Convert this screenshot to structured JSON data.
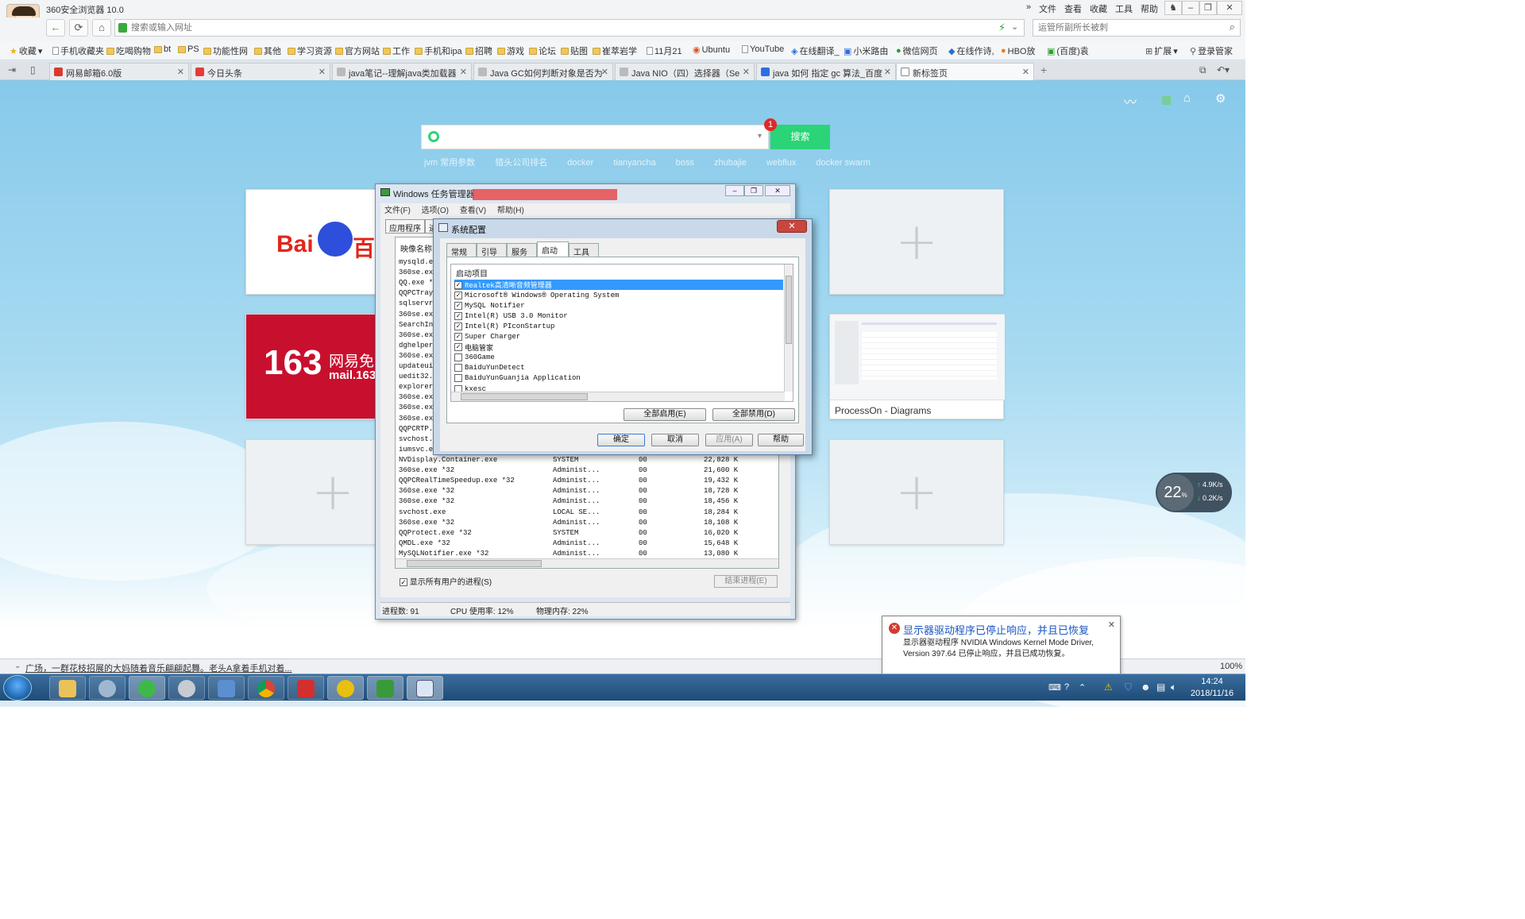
{
  "browser": {
    "title": "360安全浏览器 10.0",
    "menu": [
      "文件",
      "查看",
      "收藏",
      "工具",
      "帮助"
    ],
    "address_placeholder": "搜索或输入网址",
    "search_placeholder": "运管所副所长被刺"
  },
  "bookmarks": [
    "收藏",
    "手机收藏夹",
    "吃喝购物",
    "bt",
    "PS",
    "功能性网",
    "其他",
    "学习资源",
    "官方网站",
    "工作",
    "手机和ipa",
    "招聘",
    "游戏",
    "论坛",
    "贴图",
    "崔萃岩学",
    "11月21",
    "Ubuntu",
    "YouTube",
    "在线翻译_",
    "小米路由",
    "微信网页",
    "在线作诗,",
    "HBO放",
    "(百度)袁",
    "扩展",
    "登录管家"
  ],
  "tabs": [
    {
      "label": "网易邮箱6.0版",
      "active": false,
      "color": "#d93a2e"
    },
    {
      "label": "今日头条",
      "active": false,
      "color": "#e53b3b"
    },
    {
      "label": "java笔记--理解java类加载器",
      "active": false,
      "color": "#888"
    },
    {
      "label": "Java GC如何判断对象是否为",
      "active": false,
      "color": "#888"
    },
    {
      "label": "Java NIO（四）选择器（Se",
      "active": false,
      "color": "#888"
    },
    {
      "label": "java 如何 指定 gc 算法_百度",
      "active": false,
      "color": "#2f6ee0"
    },
    {
      "label": "新标签页",
      "active": true,
      "color": "#888"
    }
  ],
  "newtab": {
    "search_button": "搜索",
    "badge_count": "1",
    "hot_words": [
      "jvm 常用参数",
      "猎头公司排名",
      "docker",
      "tianyancha",
      "boss",
      "zhubajie",
      "webflux",
      "docker swarm"
    ],
    "tiles": {
      "baidu": "百度",
      "mail163_main": "163",
      "mail163_sub": "网易免费",
      "mail163_domain": "mail.163",
      "processon": "ProcessOn - Diagrams"
    }
  },
  "taskmgr": {
    "title": "Windows 任务管理器",
    "menu": [
      "文件(F)",
      "选项(O)",
      "查看(V)",
      "帮助(H)"
    ],
    "tabs": [
      "应用程序",
      "进"
    ],
    "column_image": "映像名称",
    "processes_hidden": [
      "mysqld.e",
      "360se.exe",
      "QQ.exe *3",
      "QQPCTray",
      "sqlservr",
      "360se.exe",
      "SearchInd",
      "360se.exe",
      "dghelper.",
      "360se.exe",
      "updateui",
      "uedit32.e",
      "explorer",
      "360se.exe",
      "360se.exe",
      "360se.exe",
      "QQPCRTP.",
      "svchost.e",
      "iumsvc.ex"
    ],
    "processes": [
      {
        "name": "NVDisplay.Container.exe",
        "user": "SYSTEM",
        "cpu": "00",
        "mem": "22,828 K"
      },
      {
        "name": "360se.exe *32",
        "user": "Administ...",
        "cpu": "00",
        "mem": "21,600 K"
      },
      {
        "name": "QQPCRealTimeSpeedup.exe *32",
        "user": "Administ...",
        "cpu": "00",
        "mem": "19,432 K"
      },
      {
        "name": "360se.exe *32",
        "user": "Administ...",
        "cpu": "00",
        "mem": "18,728 K"
      },
      {
        "name": "360se.exe *32",
        "user": "Administ...",
        "cpu": "00",
        "mem": "18,456 K"
      },
      {
        "name": "svchost.exe",
        "user": "LOCAL SE...",
        "cpu": "00",
        "mem": "18,284 K"
      },
      {
        "name": "360se.exe *32",
        "user": "Administ...",
        "cpu": "00",
        "mem": "18,108 K"
      },
      {
        "name": "QQProtect.exe *32",
        "user": "SYSTEM",
        "cpu": "00",
        "mem": "16,020 K"
      },
      {
        "name": "QMDL.exe *32",
        "user": "Administ...",
        "cpu": "00",
        "mem": "15,648 K"
      },
      {
        "name": "MySQLNotifier.exe *32",
        "user": "Administ...",
        "cpu": "00",
        "mem": "13,080 K"
      }
    ],
    "show_all": "显示所有用户的进程(S)",
    "end_process": "结束进程(E)",
    "status_procs": "进程数: 91",
    "status_cpu": "CPU 使用率: 12%",
    "status_mem": "物理内存: 22%"
  },
  "syscfg": {
    "title": "系统配置",
    "tabs": [
      "常规",
      "引导",
      "服务",
      "启动",
      "工具"
    ],
    "list_header": "启动项目",
    "items": [
      {
        "name": "Realtek高清晰音频管理器",
        "checked": true,
        "selected": true
      },
      {
        "name": "Microsoft® Windows® Operating System",
        "checked": true,
        "selected": false
      },
      {
        "name": "MySQL Notifier",
        "checked": true,
        "selected": false
      },
      {
        "name": "Intel(R) USB 3.0 Monitor",
        "checked": true,
        "selected": false
      },
      {
        "name": "Intel(R) PIconStartup",
        "checked": true,
        "selected": false
      },
      {
        "name": "Super Charger",
        "checked": true,
        "selected": false
      },
      {
        "name": "电脑管家",
        "checked": true,
        "selected": false
      },
      {
        "name": "360Game",
        "checked": false,
        "selected": false
      },
      {
        "name": "BaiduYunDetect",
        "checked": false,
        "selected": false
      },
      {
        "name": "BaiduYunGuanjia Application",
        "checked": false,
        "selected": false
      },
      {
        "name": "kxesc",
        "checked": false,
        "selected": false
      }
    ],
    "enable_all": "全部启用(E)",
    "disable_all": "全部禁用(D)",
    "ok": "确定",
    "cancel": "取消",
    "apply": "应用(A)",
    "help": "帮助"
  },
  "notification": {
    "title": "显示器驱动程序已停止响应，并且已恢复",
    "body": "显示器驱动程序 NVIDIA Windows Kernel Mode Driver, Version 397.64 已停止响应，并且已成功恢复。"
  },
  "statusbar": {
    "ticker": "广场，一群花枝招展的大妈随着音乐翩翩起舞。老头A拿着手机对着..."
  },
  "taskbar": {
    "time": "14:24",
    "date": "2018/11/16"
  },
  "netwidget": {
    "cpu": "22",
    "up": "4.9K/s",
    "down": "0.2K/s"
  },
  "zoom": "100%"
}
